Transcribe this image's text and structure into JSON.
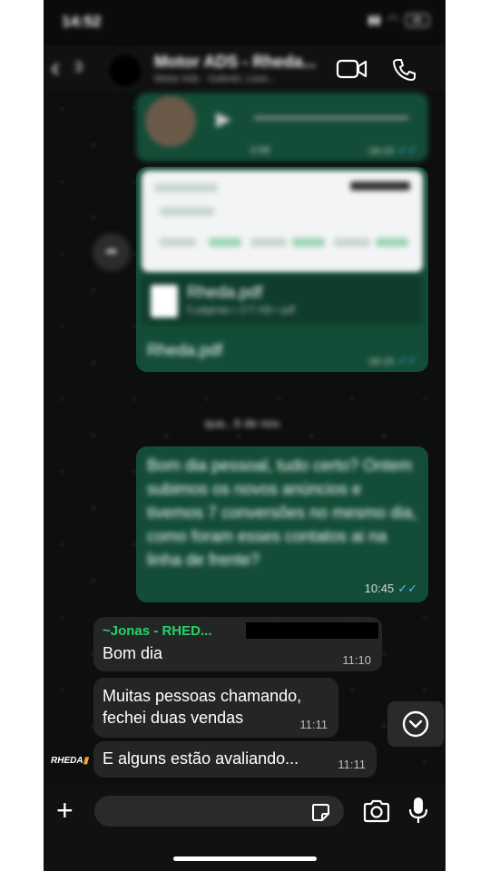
{
  "status_bar": {
    "time": "14:52",
    "battery": "21"
  },
  "header": {
    "back_count": "3",
    "title": "Motor ADS - Rheda...",
    "subtitle": "Motor Ads · Gabriel, Lean..."
  },
  "messages": {
    "audio": {
      "duration": "0:58",
      "time": "09:15"
    },
    "document": {
      "file_name": "Rheda.pdf",
      "file_meta": "5 páginas • 177 KB • pdf",
      "caption": "Rheda.pdf",
      "time": "09:15"
    },
    "date_separator": "qua., 6 de nov.",
    "outgoing_text": {
      "text": "Bom dia pessoal, tudo certo? Ontem subimos os novos anúncios e tivemos 7 conversões no mesmo dia, como foram esses contatos ai na linha de frente?",
      "time": "10:45"
    },
    "incoming": [
      {
        "sender": "~Jonas - RHED...",
        "text": "Bom dia",
        "time": "11:10"
      },
      {
        "text": "Muitas pessoas chamando, fechei duas vendas",
        "time": "11:11"
      },
      {
        "text": "E alguns estão avaliando...",
        "time": "11:11"
      }
    ],
    "sender_avatar_text": "RHEDA"
  },
  "colors": {
    "outgoing": "#134d37",
    "incoming": "#242626",
    "sender_name": "#25d366",
    "read_tick": "#53bdeb"
  },
  "icons": [
    "back-chevron-icon",
    "video-call-icon",
    "phone-icon",
    "play-icon",
    "forward-icon",
    "pdf-icon",
    "double-check-icon",
    "chevron-down-icon",
    "plus-icon",
    "sticker-icon",
    "camera-icon",
    "mic-icon"
  ]
}
